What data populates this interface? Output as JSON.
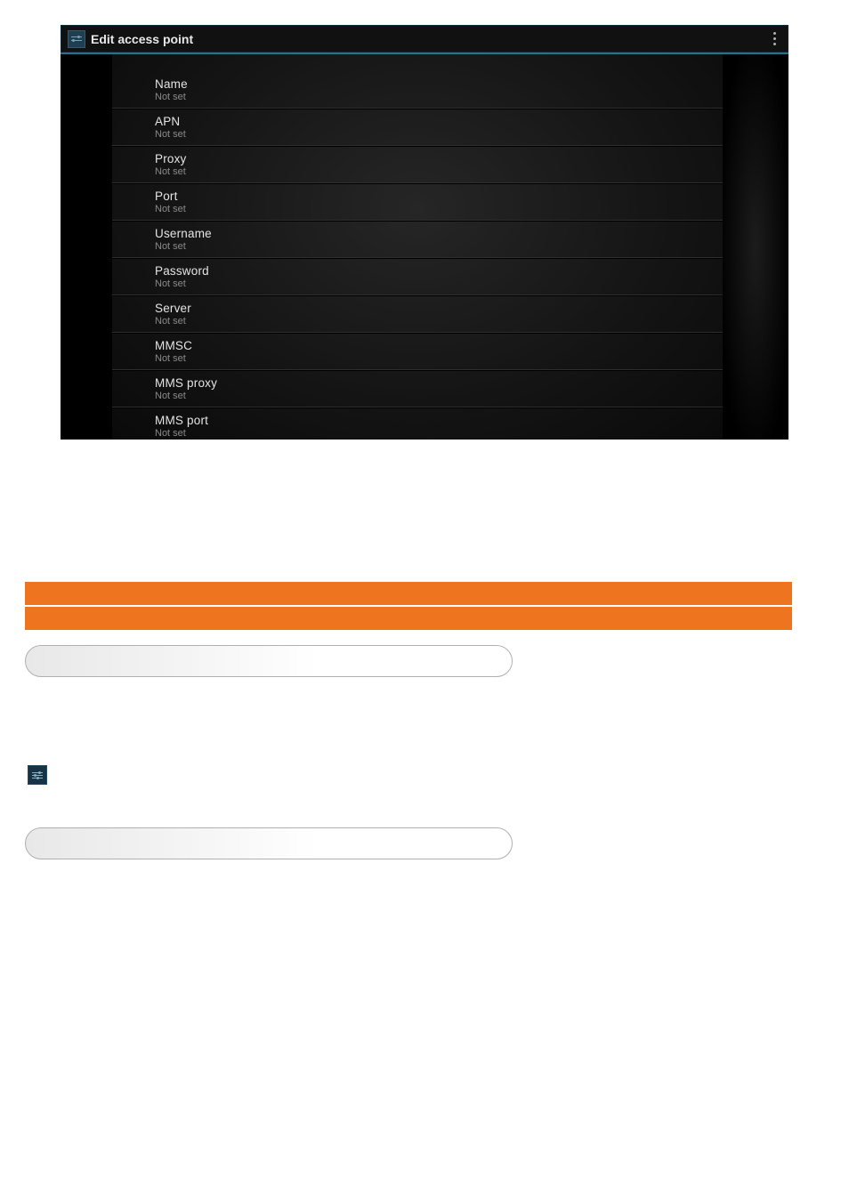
{
  "screenshot": {
    "titlebar": {
      "title": "Edit access point",
      "settings_icon_name": "settings-icon",
      "overflow_icon_name": "overflow-menu-icon"
    },
    "items": [
      {
        "label": "Name",
        "value": "Not set"
      },
      {
        "label": "APN",
        "value": "Not set"
      },
      {
        "label": "Proxy",
        "value": "Not set"
      },
      {
        "label": "Port",
        "value": "Not set"
      },
      {
        "label": "Username",
        "value": "Not set"
      },
      {
        "label": "Password",
        "value": "Not set"
      },
      {
        "label": "Server",
        "value": "Not set"
      },
      {
        "label": "MMSC",
        "value": "Not set"
      },
      {
        "label": "MMS proxy",
        "value": "Not set"
      },
      {
        "label": "MMS port",
        "value": "Not set"
      }
    ]
  },
  "section_bars": {
    "bar1": "",
    "bar2": ""
  },
  "pills": {
    "pill1_text": "",
    "pill1_desc": "",
    "pill2_text": "",
    "pill2_desc": ""
  },
  "body": {
    "para1": "",
    "para2_prefix": "",
    "para2_suffix": "",
    "para3": ""
  },
  "inline_icon_name": "settings-sliders-icon",
  "page_number": ""
}
